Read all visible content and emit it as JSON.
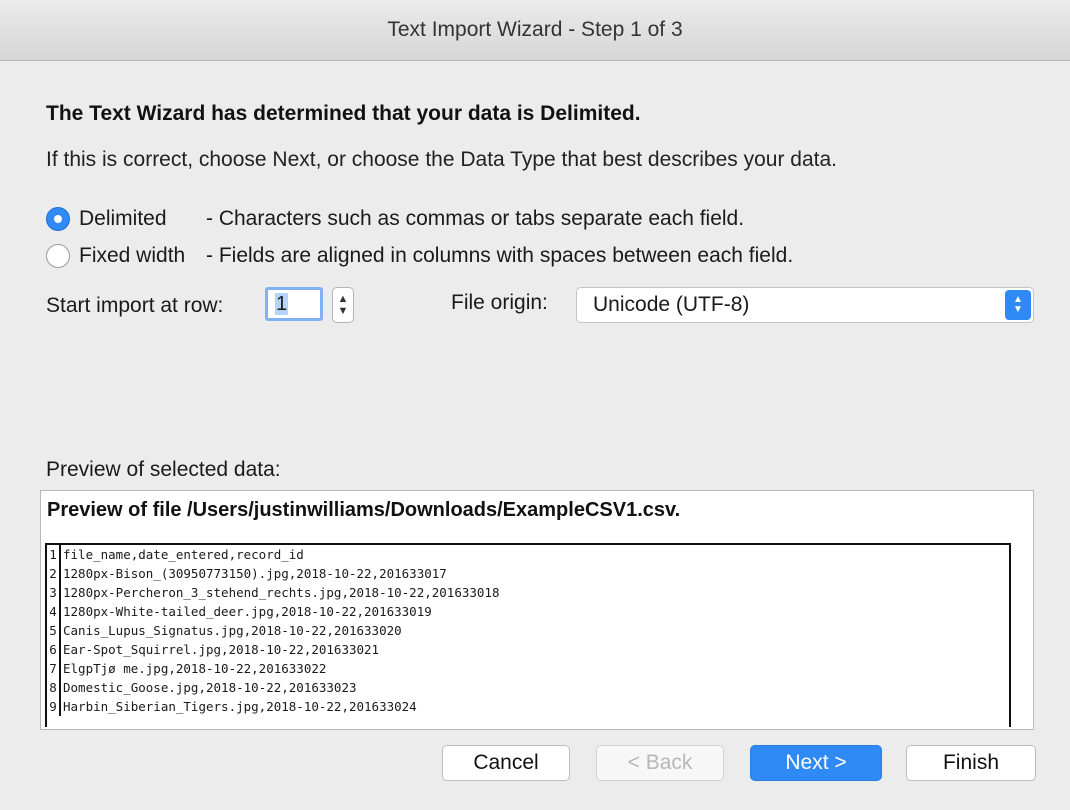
{
  "window": {
    "title": "Text Import Wizard - Step 1 of 3"
  },
  "intro": {
    "heading": "The Text Wizard has determined that your data is Delimited.",
    "subtext": "If this is correct, choose Next, or choose the Data Type that best describes your data."
  },
  "data_type": {
    "options": [
      {
        "label": "Delimited",
        "description": "- Characters such as commas or tabs separate each field.",
        "selected": true
      },
      {
        "label": "Fixed width",
        "description": "- Fields are aligned in columns with spaces between each field.",
        "selected": false
      }
    ]
  },
  "start_row": {
    "label": "Start import at row:",
    "value": "1"
  },
  "file_origin": {
    "label": "File origin:",
    "value": "Unicode (UTF-8)"
  },
  "preview": {
    "label": "Preview of selected data:",
    "title": "Preview of file /Users/justinwilliams/Downloads/ExampleCSV1.csv.",
    "rows": [
      {
        "n": "1",
        "text": "file_name,date_entered,record_id"
      },
      {
        "n": "2",
        "text": "1280px-Bison_(30950773150).jpg,2018-10-22,201633017"
      },
      {
        "n": "3",
        "text": "1280px-Percheron_3_stehend_rechts.jpg,2018-10-22,201633018"
      },
      {
        "n": "4",
        "text": "1280px-White-tailed_deer.jpg,2018-10-22,201633019"
      },
      {
        "n": "5",
        "text": "Canis_Lupus_Signatus.jpg,2018-10-22,201633020"
      },
      {
        "n": "6",
        "text": "Ear-Spot_Squirrel.jpg,2018-10-22,201633021"
      },
      {
        "n": "7",
        "text": "ElgpTjø me.jpg,2018-10-22,201633022"
      },
      {
        "n": "8",
        "text": "Domestic_Goose.jpg,2018-10-22,201633023"
      },
      {
        "n": "9",
        "text": "Harbin_Siberian_Tigers.jpg,2018-10-22,201633024"
      }
    ]
  },
  "buttons": {
    "cancel": "Cancel",
    "back": "< Back",
    "next": "Next >",
    "finish": "Finish"
  },
  "colors": {
    "accent": "#2f8af5",
    "background": "#ececec"
  }
}
